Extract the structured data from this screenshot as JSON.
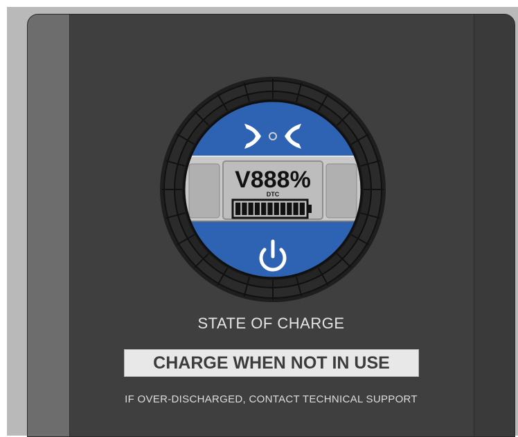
{
  "display": {
    "readout_prefix": "V",
    "readout_digits": "888",
    "readout_suffix": "%",
    "small_code": "DTC",
    "battery_segments": 11
  },
  "labels": {
    "state_of_charge": "STATE OF CHARGE",
    "charge_notice": "CHARGE WHEN NOT IN USE",
    "support_notice": "IF OVER-DISCHARGED, CONTACT TECHNICAL SUPPORT"
  },
  "icons": {
    "connect": "bluetooth-link-icon",
    "power": "power-icon"
  },
  "colors": {
    "panel": "#3f3f3f",
    "accent_blue": "#2e63b3",
    "lcd": "#bdbdbd",
    "bezel": "#262626"
  }
}
